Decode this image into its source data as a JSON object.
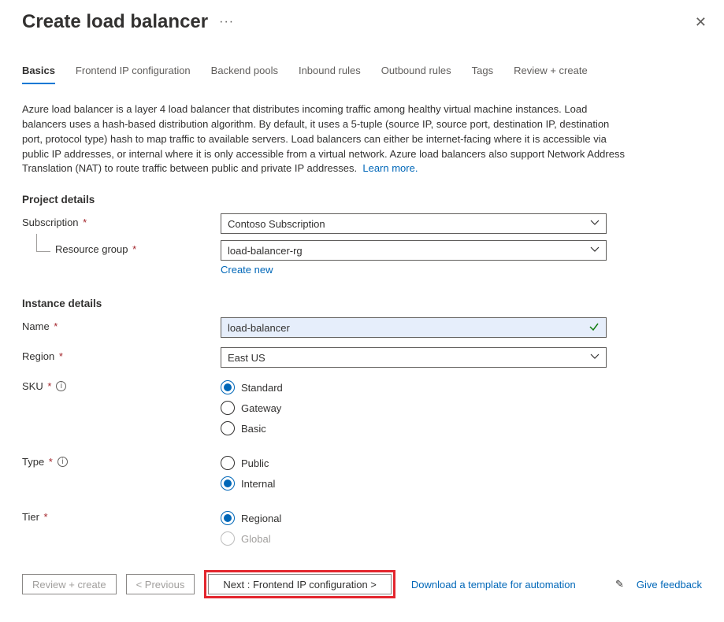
{
  "header": {
    "title": "Create load balancer"
  },
  "tabs": {
    "basics": "Basics",
    "frontend": "Frontend IP configuration",
    "backend": "Backend pools",
    "inbound": "Inbound rules",
    "outbound": "Outbound rules",
    "tags": "Tags",
    "review": "Review + create"
  },
  "description": "Azure load balancer is a layer 4 load balancer that distributes incoming traffic among healthy virtual machine instances. Load balancers uses a hash-based distribution algorithm. By default, it uses a 5-tuple (source IP, source port, destination IP, destination port, protocol type) hash to map traffic to available servers. Load balancers can either be internet-facing where it is accessible via public IP addresses, or internal where it is only accessible from a virtual network. Azure load balancers also support Network Address Translation (NAT) to route traffic between public and private IP addresses.",
  "learn_more": "Learn more.",
  "sections": {
    "project": "Project details",
    "instance": "Instance details"
  },
  "fields": {
    "subscription_label": "Subscription",
    "subscription_value": "Contoso Subscription",
    "rg_label": "Resource group",
    "rg_value": "load-balancer-rg",
    "create_new": "Create new",
    "name_label": "Name",
    "name_value": "load-balancer",
    "region_label": "Region",
    "region_value": "East US",
    "sku_label": "SKU",
    "sku_options": {
      "standard": "Standard",
      "gateway": "Gateway",
      "basic": "Basic"
    },
    "type_label": "Type",
    "type_options": {
      "public": "Public",
      "internal": "Internal"
    },
    "tier_label": "Tier",
    "tier_options": {
      "regional": "Regional",
      "global": "Global"
    }
  },
  "footer": {
    "review": "Review + create",
    "previous": "<  Previous",
    "next": "Next : Frontend IP configuration >",
    "download": "Download a template for automation",
    "feedback": "Give feedback"
  },
  "colors": {
    "accent": "#0078d4",
    "link": "#0067b8",
    "required": "#a4262c",
    "highlight_border": "#e3262e"
  }
}
